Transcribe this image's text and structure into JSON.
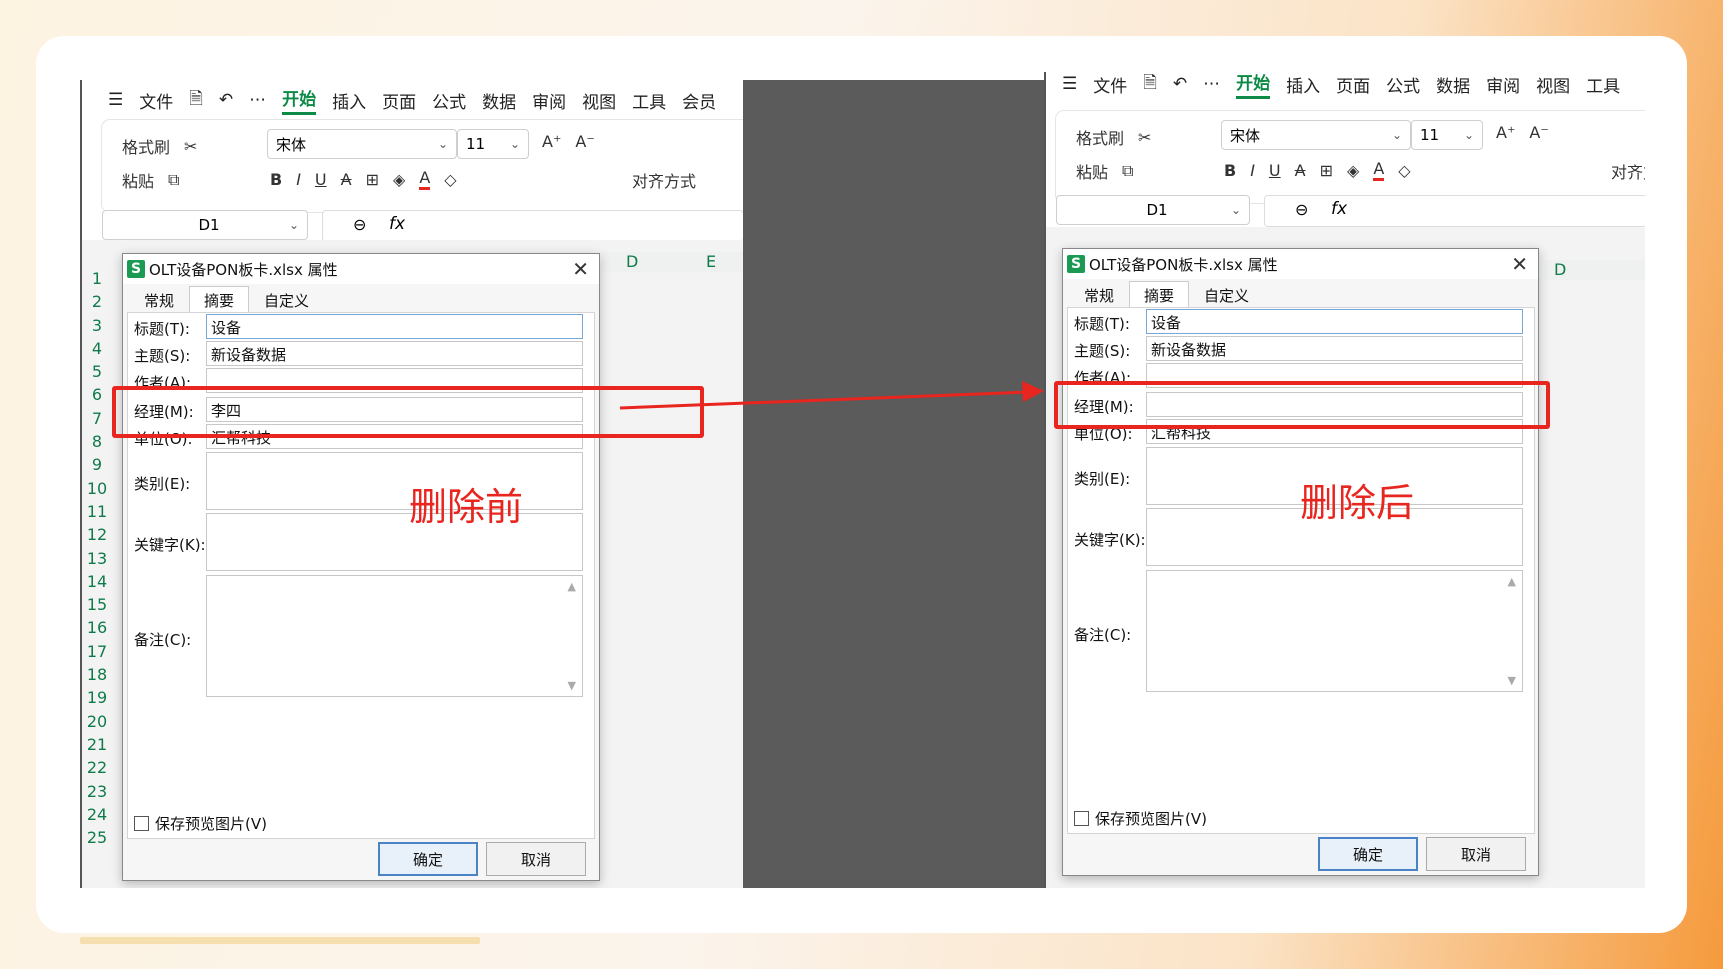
{
  "colors": {
    "accent_green": "#0d8a47",
    "annotation_red": "#e8251e",
    "button_border": "#4a84c6"
  },
  "toolbar": {
    "menu_icon": "☰",
    "file": "文件",
    "tabs": [
      "开始",
      "插入",
      "页面",
      "公式",
      "数据",
      "审阅",
      "视图",
      "工具",
      "会员"
    ],
    "format_painter": "格式刷",
    "paste": "粘贴",
    "font_name": "宋体",
    "font_size": "11",
    "align": "对齐方式",
    "cell_ref": "D1",
    "fx": "fx"
  },
  "grid": {
    "row_numbers": [
      "1",
      "2",
      "3",
      "4",
      "5",
      "6",
      "7",
      "8",
      "9",
      "10",
      "11",
      "12",
      "13",
      "14",
      "15",
      "16",
      "17",
      "18",
      "19",
      "20",
      "21",
      "22",
      "23",
      "24",
      "25"
    ],
    "col_d": "D",
    "col_e": "E"
  },
  "dialog": {
    "title": "OLT设备PON板卡.xlsx 属性",
    "tabs": [
      "常规",
      "摘要",
      "自定义"
    ],
    "labels": {
      "title": "标题(T):",
      "subject": "主题(S):",
      "author": "作者(A):",
      "manager": "经理(M):",
      "company": "单位(O):",
      "category": "类别(E):",
      "keywords": "关键字(K):",
      "comments": "备注(C):"
    },
    "save_preview": "保存预览图片(V)",
    "ok": "确定",
    "cancel": "取消"
  },
  "before": {
    "title_value": "设备",
    "subject_value": "新设备数据",
    "author_value": "",
    "manager_value": "李四",
    "company_value": "汇帮科技",
    "annotation": "删除前"
  },
  "after": {
    "title_value": "设备",
    "subject_value": "新设备数据",
    "author_value": "",
    "manager_value": "",
    "company_value": "汇帮科技",
    "annotation": "删除后"
  }
}
